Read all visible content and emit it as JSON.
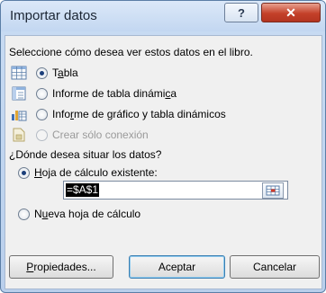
{
  "window": {
    "title": "Importar datos",
    "help_glyph": "?",
    "close_glyph": "✕"
  },
  "prompt1": "Seleccione cómo desea ver estos datos en el libro.",
  "view_options": [
    {
      "label_pre": "T",
      "label_u": "a",
      "label_post": "bla",
      "selected": true,
      "enabled": true,
      "icon": "table-icon"
    },
    {
      "label_pre": "Informe de tabla dinámi",
      "label_u": "c",
      "label_post": "a",
      "selected": false,
      "enabled": true,
      "icon": "pivot-table-icon"
    },
    {
      "label_pre": "Info",
      "label_u": "r",
      "label_post": "me de gráfico y tabla dinámicos",
      "selected": false,
      "enabled": true,
      "icon": "pivot-chart-icon"
    },
    {
      "label_pre": "Crear sólo conexión",
      "label_u": "",
      "label_post": "",
      "selected": false,
      "enabled": false,
      "icon": "connection-icon"
    }
  ],
  "prompt2": "¿Dónde desea situar los datos?",
  "location_options": [
    {
      "label_pre": "",
      "label_u": "H",
      "label_post": "oja de cálculo existente:",
      "selected": true
    },
    {
      "label_pre": "N",
      "label_u": "u",
      "label_post": "eva hoja de cálculo",
      "selected": false
    }
  ],
  "range_value": "=$A$1",
  "buttons": {
    "properties_u": "P",
    "properties_rest": "ropiedades...",
    "accept": "Aceptar",
    "cancel": "Cancelar"
  }
}
